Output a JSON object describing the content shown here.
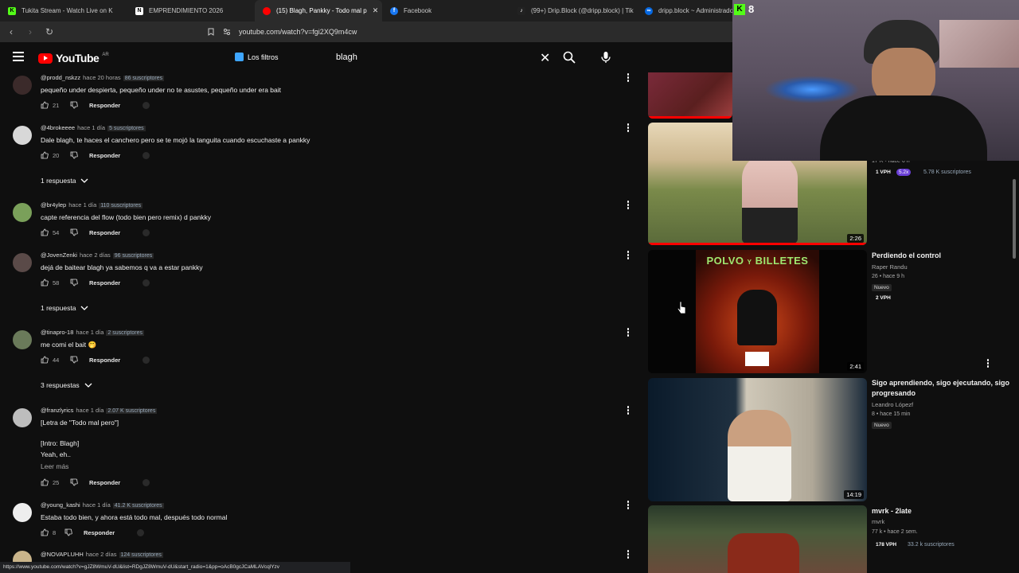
{
  "browser": {
    "tabs": [
      {
        "label": "Tukita Stream - Watch Live on K",
        "icon": "kick-favicon",
        "color": "#53fc18",
        "active": false
      },
      {
        "label": "EMPRENDIMIENTO 2026",
        "icon": "notion-favicon",
        "color": "#ffffff",
        "active": false
      },
      {
        "label": "(15) Blagh, Pankky - Todo mal p",
        "icon": "youtube-favicon",
        "color": "#ff0000",
        "active": true
      },
      {
        "label": "Facebook",
        "icon": "facebook-favicon",
        "color": "#1877f2",
        "active": false
      },
      {
        "label": "(99+) Drip.Block (@dripp.block) | Tik",
        "icon": "tiktok-favicon",
        "color": "#ffffff",
        "active": false
      },
      {
        "label": "dripp.block ~ Administrado",
        "icon": "meta-favicon",
        "color": "#0668e1",
        "active": false
      }
    ],
    "url": "youtube.com/watch?v=fgi2XQ9m4cw",
    "status_url": "https://www.youtube.com/watch?v=gJZ8WmuV-dU&list=RDgJZ8WmuV-dU&start_radio=1&pp=oAcB0gcJCaMLAVcqlYzv"
  },
  "youtube": {
    "logo_text": "YouTube",
    "country": "AR",
    "filters_label": "Los filtros",
    "search_value": "blagh"
  },
  "comments": [
    {
      "user": "@prodd_nskzz",
      "time": "hace 20 horas",
      "subs": "86 suscriptores",
      "text": "pequeño under despierta, pequeño under no te asustes, pequeño under era bait",
      "likes": "21",
      "reply": "Responder",
      "avatar_color": "#3b2a2a"
    },
    {
      "user": "@4brokeeee",
      "time": "hace 1 día",
      "subs": "5 suscriptores",
      "text": "Dale blagh, te haces el canchero pero se te mojó la tanguita cuando escuchaste a pankky",
      "likes": "20",
      "reply": "Responder",
      "avatar_color": "#d8d8d8",
      "replies_label": "1 respuesta"
    },
    {
      "user": "@br4ylep",
      "time": "hace 1 día",
      "subs": "110 suscriptores",
      "text": "capte referencia del flow  (todo bien pero remix) d pankky",
      "likes": "54",
      "reply": "Responder",
      "avatar_color": "#7aa05a"
    },
    {
      "user": "@JovenZenki",
      "time": "hace 2 días",
      "subs": "96 suscriptores",
      "text": "dejá de baitear blagh ya sabemos q va a estar pankky",
      "likes": "58",
      "reply": "Responder",
      "avatar_color": "#5a4a48",
      "replies_label": "1 respuesta"
    },
    {
      "user": "@tinapro-18",
      "time": "hace 1 día",
      "subs": "2 suscriptores",
      "text": "me comi el bait 🤭",
      "likes": "44",
      "reply": "Responder",
      "avatar_color": "#6a7a5a",
      "replies_label": "3 respuestas"
    },
    {
      "user": "@franzlyrics",
      "time": "hace 1 día",
      "subs": "2.07 K suscriptores",
      "text": "[Letra de \"Todo mal pero\"]",
      "text2": "[Intro: Blagh]",
      "text3": "Yeah, eh..",
      "more": "Leer más",
      "likes": "25",
      "reply": "Responder",
      "avatar_color": "#bdbdbd"
    },
    {
      "user": "@young_kashi",
      "time": "hace 1 día",
      "subs": "41.2 K suscriptores",
      "text": "Estaba todo bien, y ahora está todo mal, después todo normal",
      "likes": "8",
      "reply": "Responder",
      "avatar_color": "#eeeeee"
    },
    {
      "user": "@NOVAPLUHH",
      "time": "hace 2 días",
      "subs": "124 suscriptores",
      "avatar_color": "#c9b48a"
    }
  ],
  "sidebar": {
    "partial_top": {
      "stats": "17 K • hace 6 h",
      "vph": "1 VPH",
      "ratio": "5.2x",
      "subs": "5.78 K suscriptores"
    },
    "video_2": {
      "duration": "2:26"
    },
    "video_3": {
      "title": "Perdiendo el control",
      "channel": "Raper Randu",
      "stats": "26 • hace 9 h",
      "badge": "Nuevo",
      "vph": "2 VPH",
      "duration": "2:41",
      "thumb_text_1": "POLVO",
      "thumb_text_2": "BILLETES",
      "thumb_text_3": "Y"
    },
    "video_4": {
      "title": "Sigo aprendiendo, sigo ejecutando, sigo progresando",
      "channel": "Leandro Lópezf",
      "stats": "8 • hace 15 min",
      "badge": "Nuevo",
      "duration": "14:19"
    },
    "video_5": {
      "title": "mvrk - 2late",
      "channel": "mvrk",
      "stats": "77 k • hace 2 sem.",
      "vph": "178 VPH",
      "subs": "33.2 k suscriptores"
    }
  },
  "overlay": {
    "kick_count": "8"
  }
}
